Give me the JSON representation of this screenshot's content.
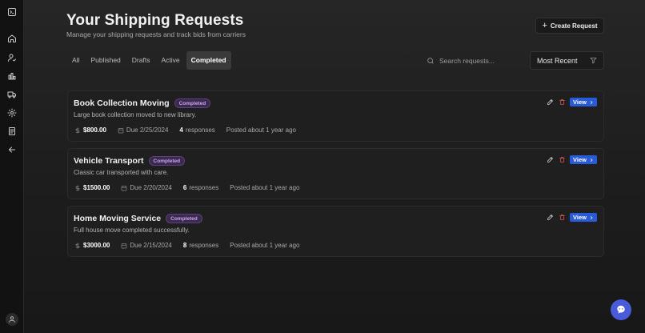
{
  "header": {
    "title": "Your Shipping Requests",
    "subtitle": "Manage your shipping requests and track bids from carriers",
    "create_label": "Create Request"
  },
  "tabs": [
    {
      "label": "All"
    },
    {
      "label": "Published"
    },
    {
      "label": "Drafts"
    },
    {
      "label": "Active"
    },
    {
      "label": "Completed"
    }
  ],
  "search": {
    "placeholder": "Search requests..."
  },
  "sort": {
    "selected": "Most Recent"
  },
  "requests": [
    {
      "title": "Book Collection Moving",
      "status": "Completed",
      "description": "Large book collection moved to new library.",
      "price": "$800.00",
      "due": "Due 2/25/2024",
      "responses_count": "4",
      "responses_label": "responses",
      "posted": "Posted about 1 year ago",
      "view_label": "View"
    },
    {
      "title": "Vehicle Transport",
      "status": "Completed",
      "description": "Classic car transported with care.",
      "price": "$1500.00",
      "due": "Due 2/20/2024",
      "responses_count": "6",
      "responses_label": "responses",
      "posted": "Posted about 1 year ago",
      "view_label": "View"
    },
    {
      "title": "Home Moving Service",
      "status": "Completed",
      "description": "Full house move completed successfully.",
      "price": "$3000.00",
      "due": "Due 2/15/2024",
      "responses_count": "8",
      "responses_label": "responses",
      "posted": "Posted about 1 year ago",
      "view_label": "View"
    }
  ],
  "colors": {
    "accent_blue": "#2a5bd7",
    "badge_purple": "#c9a3f0",
    "delete_red": "#e05555",
    "chat_fab": "#4a5bd9"
  },
  "sidebar_icons": [
    "terminal-icon",
    "home-icon",
    "user-check-icon",
    "chart-icon",
    "truck-icon",
    "settings-icon",
    "document-icon",
    "arrow-left-icon"
  ]
}
